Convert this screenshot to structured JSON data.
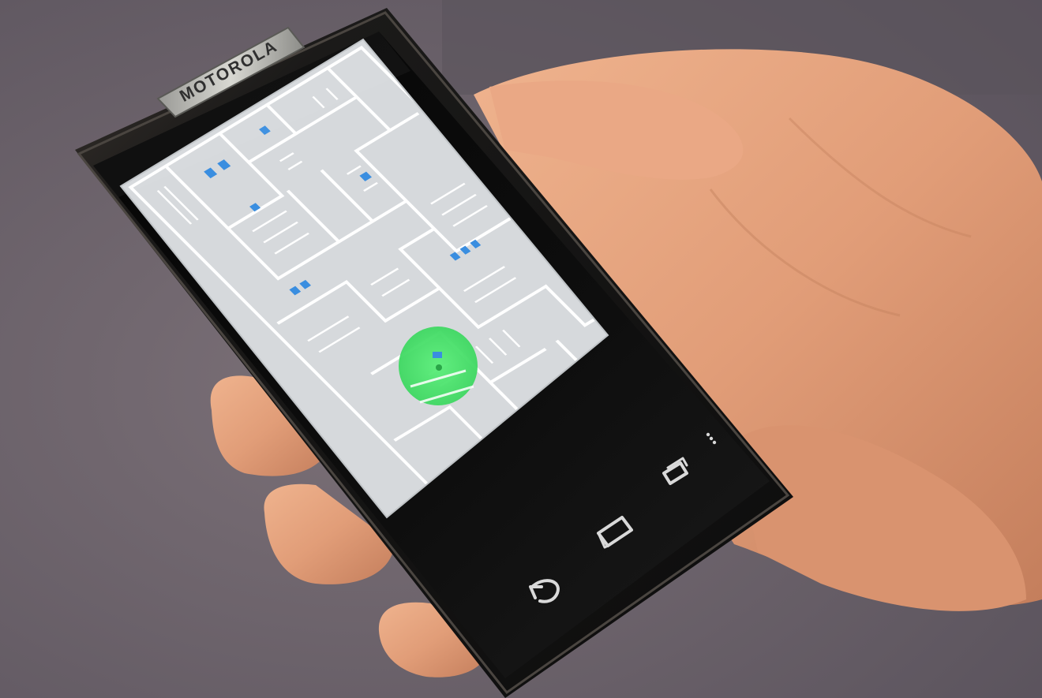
{
  "phone": {
    "brand_label": "MOTOROLA",
    "body_color": "#141414",
    "bezel_color": "#2a2622",
    "screen_map_bg": "#d6d9dc",
    "map_wall_color": "#ffffff",
    "map_marker_color": "#3a8ee0",
    "location_circle_color": "#48e06a"
  },
  "nav_bar": {
    "back_icon": "back-arrow-icon",
    "home_icon": "home-icon",
    "recents_icon": "recent-apps-icon",
    "menu_icon": "overflow-menu-icon"
  },
  "background": {
    "wall_color": "#6e6572",
    "skin_color": "#e2a07b"
  }
}
